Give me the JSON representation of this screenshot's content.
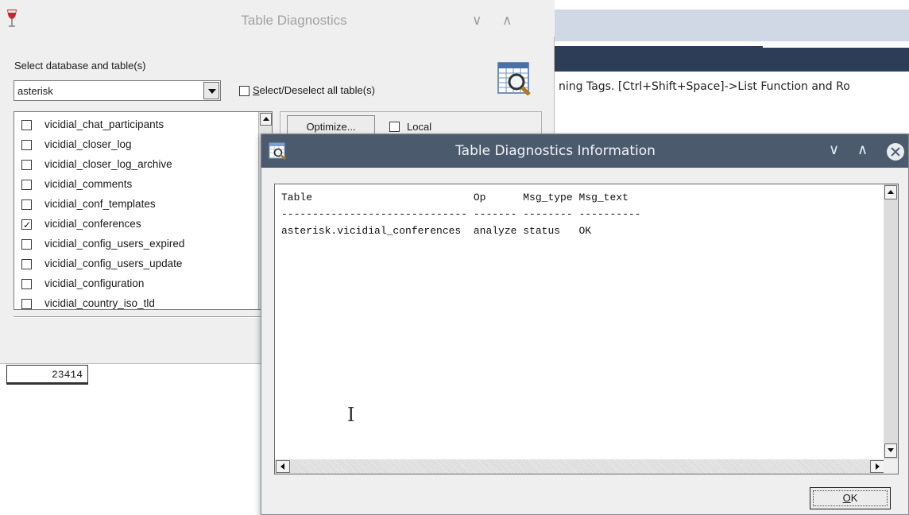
{
  "background_editor": {
    "hint_text": "ning Tags. [Ctrl+Shift+Space]->List Function and Ro",
    "grid_value": "23414"
  },
  "table_diagnostics": {
    "title": "Table Diagnostics",
    "select_label": "Select database and table(s)",
    "database_value": "asterisk",
    "select_all_prefix": "S",
    "select_all_rest": "elect/Deselect all table(s)",
    "optimize_label": "Optimize...",
    "local_label": "Local",
    "tables": [
      {
        "name": "vicidial_chat_participants",
        "checked": false
      },
      {
        "name": "vicidial_closer_log",
        "checked": false
      },
      {
        "name": "vicidial_closer_log_archive",
        "checked": false
      },
      {
        "name": "vicidial_comments",
        "checked": false
      },
      {
        "name": "vicidial_conf_templates",
        "checked": false
      },
      {
        "name": "vicidial_conferences",
        "checked": true
      },
      {
        "name": "vicidial_config_users_expired",
        "checked": false
      },
      {
        "name": "vicidial_config_users_update",
        "checked": false
      },
      {
        "name": "vicidial_configuration",
        "checked": false
      },
      {
        "name": "vicidial_country_iso_tld",
        "checked": false
      }
    ]
  },
  "info_dialog": {
    "title": "Table Diagnostics Information",
    "columns": [
      "Table",
      "Op",
      "Msg_type",
      "Msg_text"
    ],
    "rows": [
      [
        "asterisk.vicidial_conferences",
        "analyze",
        "status",
        "OK"
      ]
    ],
    "ok_prefix": "O",
    "ok_rest": "K"
  }
}
